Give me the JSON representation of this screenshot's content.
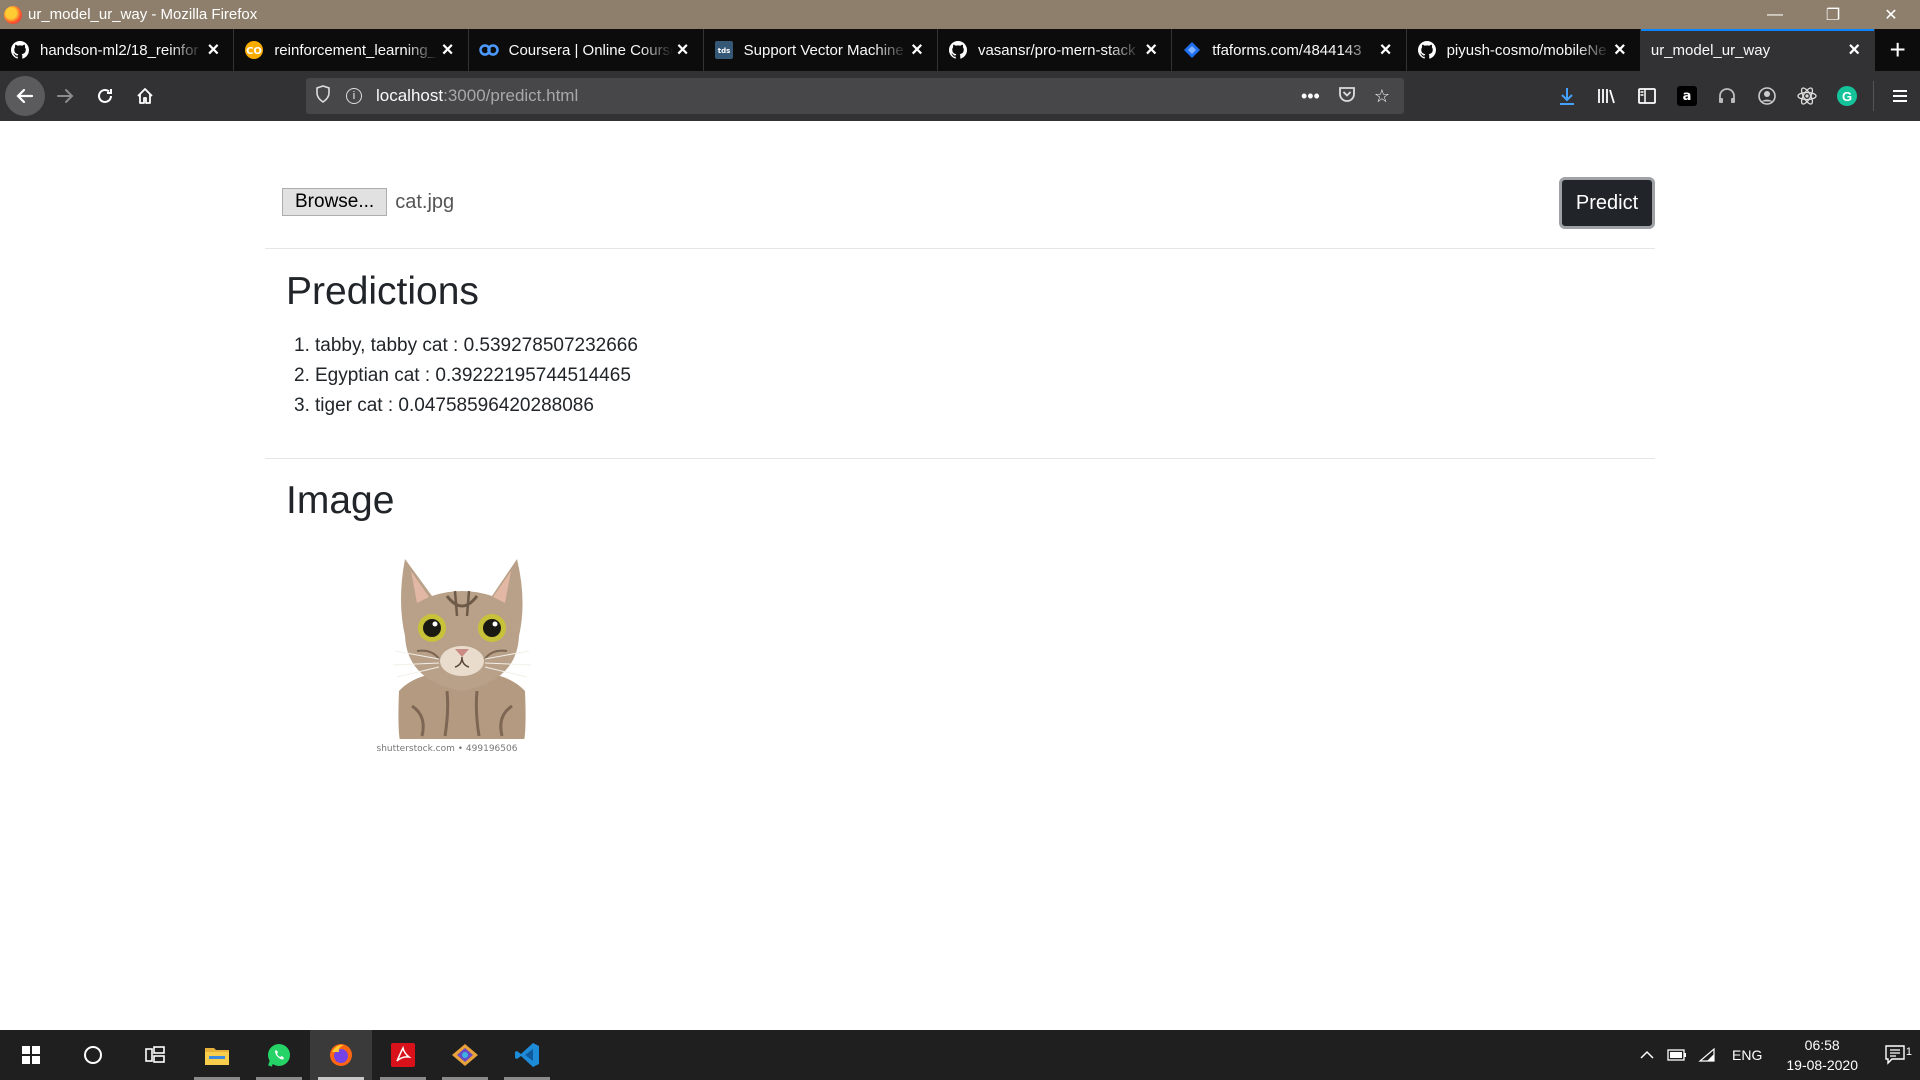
{
  "window": {
    "title": "ur_model_ur_way - Mozilla Firefox",
    "minimize": "—",
    "restore": "❐",
    "close": "✕"
  },
  "tabs": [
    {
      "title": "handson-ml2/18_reinfor",
      "icon": "github-icon"
    },
    {
      "title": "reinforcement_learning_",
      "icon": "colab-icon"
    },
    {
      "title": "Coursera | Online Course",
      "icon": "coursera-icon"
    },
    {
      "title": "Support Vector Machine",
      "icon": "tds-icon"
    },
    {
      "title": "vasansr/pro-mern-stack",
      "icon": "github-icon"
    },
    {
      "title": "tfaforms.com/4844143",
      "icon": "formassembly-icon"
    },
    {
      "title": "piyush-cosmo/mobileNe",
      "icon": "github-icon"
    },
    {
      "title": "ur_model_ur_way",
      "icon": "none",
      "active": true
    }
  ],
  "urlbar": {
    "host": "localhost",
    "rest": ":3000/predict.html"
  },
  "page": {
    "browse_label": "Browse...",
    "file_name": "cat.jpg",
    "predict_label": "Predict",
    "predictions_heading": "Predictions",
    "predictions": [
      {
        "num": "1.",
        "text": "tabby, tabby cat : 0.539278507232666"
      },
      {
        "num": "2.",
        "text": "Egyptian cat : 0.39222195744514465"
      },
      {
        "num": "3.",
        "text": "tiger cat : 0.04758596420288086"
      }
    ],
    "image_heading": "Image",
    "image_caption": "shutterstock.com • 499196506"
  },
  "taskbar": {
    "lang": "ENG",
    "time": "06:58",
    "date": "19-08-2020",
    "notifications": "1"
  },
  "colors": {
    "titlebar": "#8d7f6c",
    "tabstrip": "#0c0c0d",
    "toolbar": "#323234",
    "accent": "#0a84ff",
    "predict_button": "#212529"
  }
}
